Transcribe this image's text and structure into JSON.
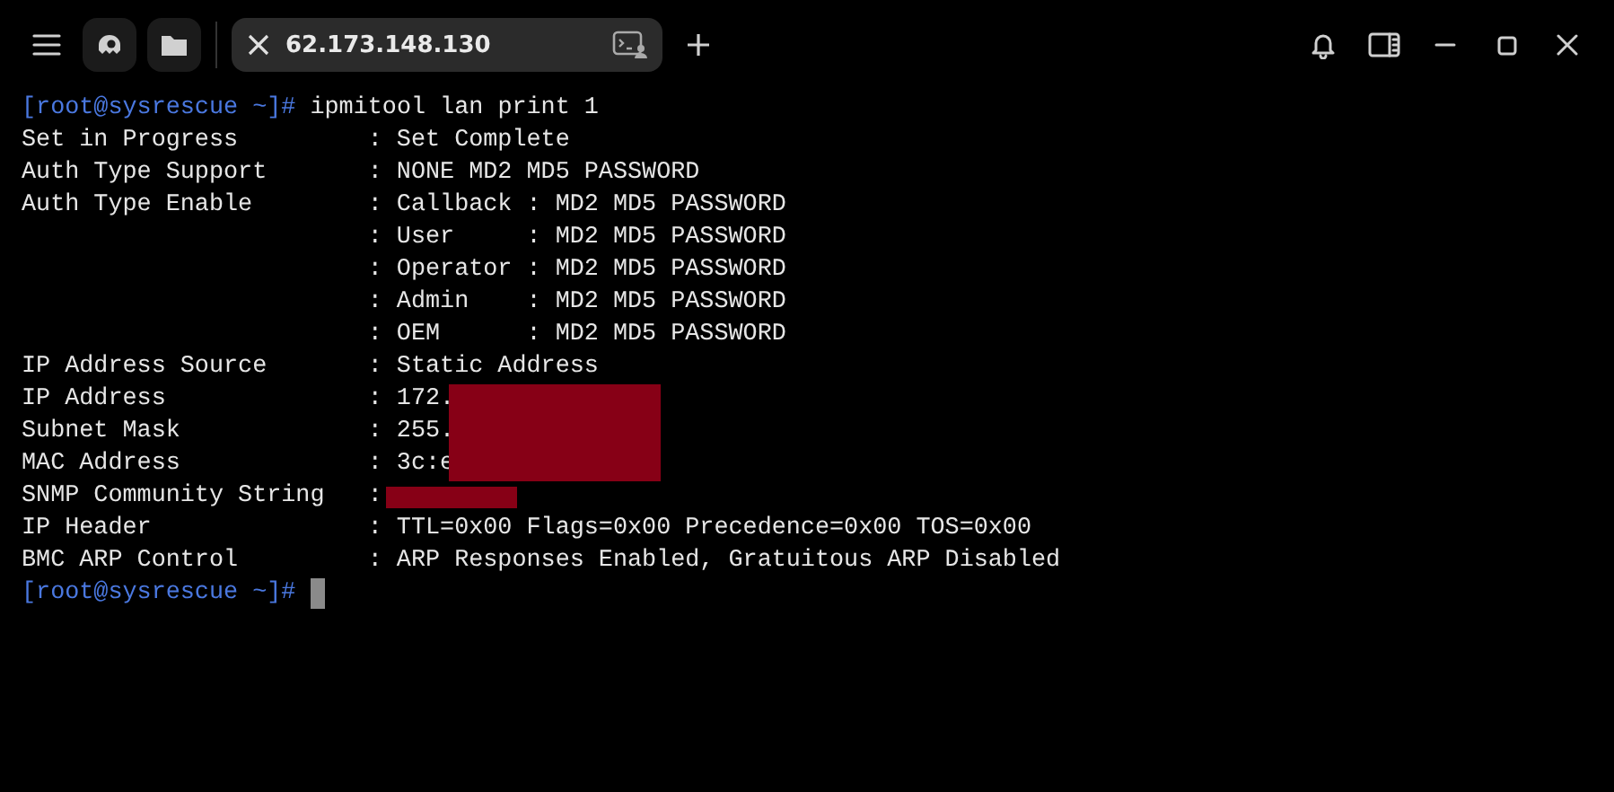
{
  "tab": {
    "title": "62.173.148.130",
    "selected": true
  },
  "terminal": {
    "lines": [
      {
        "kind": "prompt",
        "prompt": "[root@sysrescue ~]#",
        "command": "ipmitool lan print 1",
        "cursor": false
      },
      {
        "kind": "output",
        "text": "Set in Progress         : Set Complete",
        "redacted": false
      },
      {
        "kind": "output",
        "text": "Auth Type Support       : NONE MD2 MD5 PASSWORD",
        "redacted": false
      },
      {
        "kind": "output",
        "text": "Auth Type Enable        : Callback : MD2 MD5 PASSWORD",
        "redacted": false
      },
      {
        "kind": "output",
        "text": "                        : User     : MD2 MD5 PASSWORD",
        "redacted": false
      },
      {
        "kind": "output",
        "text": "                        : Operator : MD2 MD5 PASSWORD",
        "redacted": false
      },
      {
        "kind": "output",
        "text": "                        : Admin    : MD2 MD5 PASSWORD",
        "redacted": false
      },
      {
        "kind": "output",
        "text": "                        : OEM      : MD2 MD5 PASSWORD",
        "redacted": false
      },
      {
        "kind": "output",
        "text": "IP Address Source       : Static Address",
        "redacted": false
      },
      {
        "kind": "output",
        "text": "IP Address              : 172.",
        "redacted": true
      },
      {
        "kind": "output",
        "text": "Subnet Mask             : 255.",
        "redacted": true
      },
      {
        "kind": "output",
        "text": "MAC Address             : 3c:e",
        "redacted": true
      },
      {
        "kind": "output",
        "text": "SNMP Community String   :",
        "redacted": true
      },
      {
        "kind": "output",
        "text": "IP Header               : TTL=0x00 Flags=0x00 Precedence=0x00 TOS=0x00",
        "redacted": false
      },
      {
        "kind": "output",
        "text": "BMC ARP Control         : ARP Responses Enabled, Gratuitous ARP Disabled",
        "redacted": false
      },
      {
        "kind": "prompt",
        "prompt": "[root@sysrescue ~]#",
        "cursor": true
      }
    ]
  }
}
